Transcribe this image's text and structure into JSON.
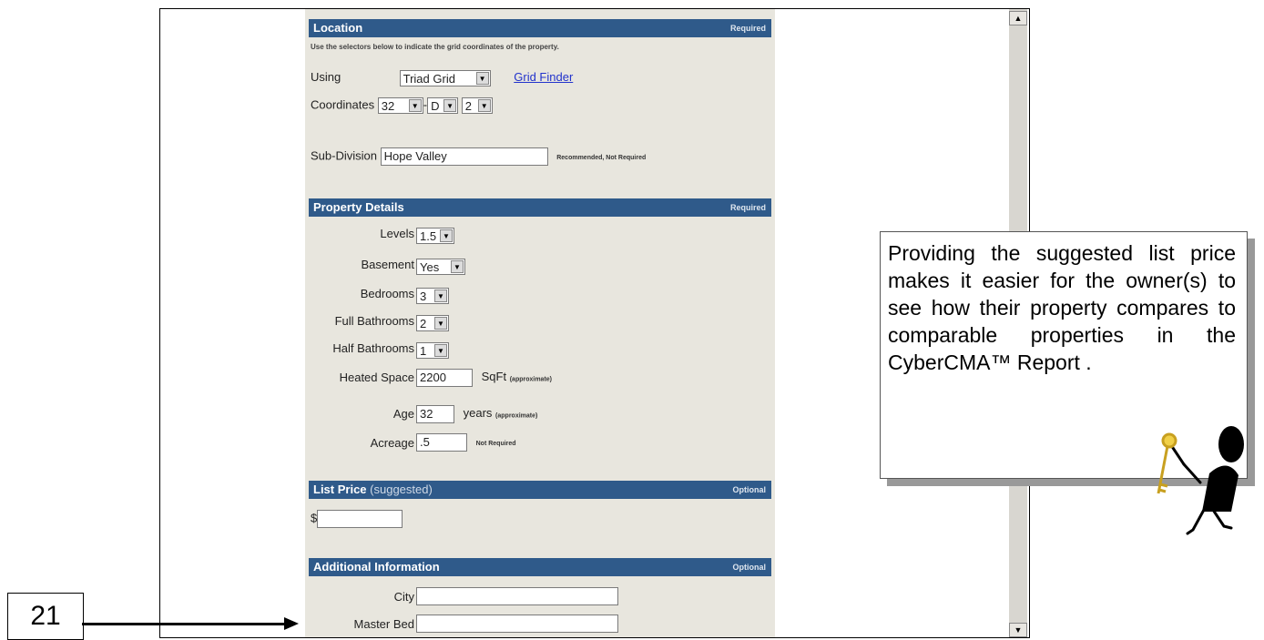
{
  "location": {
    "title": "Location",
    "tag": "Required",
    "instructions": "Use the selectors below to indicate the grid coordinates of the property.",
    "using_label": "Using",
    "using_value": "Triad Grid",
    "grid_finder": "Grid Finder",
    "coords_label": "Coordinates",
    "coord1": "32",
    "coord2": "D",
    "coord3": "2",
    "dash": "-",
    "subdivision_label": "Sub-Division",
    "subdivision_value": "Hope Valley",
    "subdivision_hint": "Recommended, Not Required"
  },
  "details": {
    "title": "Property Details",
    "tag": "Required",
    "levels_label": "Levels",
    "levels_value": "1.5",
    "basement_label": "Basement",
    "basement_value": "Yes",
    "bedrooms_label": "Bedrooms",
    "bedrooms_value": "3",
    "fullbath_label": "Full Bathrooms",
    "fullbath_value": "2",
    "halfbath_label": "Half Bathrooms",
    "halfbath_value": "1",
    "heated_label": "Heated Space",
    "heated_value": "2200",
    "heated_unit": "SqFt",
    "heated_hint": "(approximate)",
    "age_label": "Age",
    "age_value": "32",
    "age_unit": "years",
    "age_hint": "(approximate)",
    "acreage_label": "Acreage",
    "acreage_value": ".5",
    "acreage_hint": "Not Required"
  },
  "price": {
    "title": "List Price",
    "subtitle": "(suggested)",
    "tag": "Optional",
    "currency": "$",
    "value": ""
  },
  "additional": {
    "title": "Additional Information",
    "tag": "Optional",
    "city_label": "City",
    "city_value": "",
    "next_label": "Master Bed"
  },
  "callout": {
    "text": "Providing the suggested list price makes it easier for the owner(s) to see how their property compares to comparable properties in the CyberCMA™ Report ."
  },
  "step": {
    "number": "21"
  },
  "scrollbar": {
    "up": "▲",
    "down": "▼"
  },
  "icons": {
    "dropdown": "▼"
  }
}
